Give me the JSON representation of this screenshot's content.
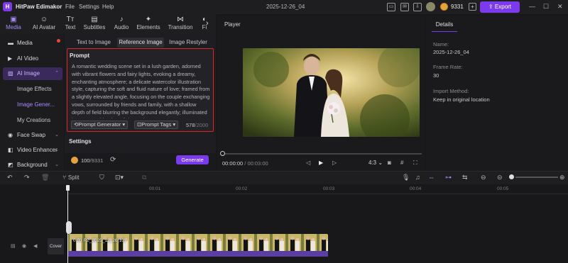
{
  "app": {
    "name": "HitPaw Edimakor",
    "menus": [
      "File",
      "Settings",
      "Help"
    ],
    "project_title": "2025-12-26_04",
    "coins": "9331",
    "export_label": "Export"
  },
  "top_tabs": [
    {
      "label": "Media",
      "icon": "media-icon",
      "active": true
    },
    {
      "label": "AI Avatar",
      "icon": "ai-avatar-icon"
    },
    {
      "label": "Text",
      "icon": "text-icon"
    },
    {
      "label": "Subtitles",
      "icon": "subtitles-icon"
    },
    {
      "label": "Audio",
      "icon": "audio-icon"
    },
    {
      "label": "Elements",
      "icon": "elements-icon"
    },
    {
      "label": "Transition",
      "icon": "transition-icon"
    },
    {
      "label": "Fi",
      "icon": "filters-icon"
    }
  ],
  "sidebar": {
    "items": [
      {
        "label": "Media"
      },
      {
        "label": "AI Video"
      },
      {
        "label": "AI Image",
        "active": true
      },
      {
        "label": "Face Swap"
      },
      {
        "label": "Video Enhancer"
      },
      {
        "label": "Background"
      }
    ],
    "sub_items": [
      {
        "label": "Image Effects"
      },
      {
        "label": "Image Gener...",
        "active": true
      },
      {
        "label": "My Creations"
      }
    ]
  },
  "image_tabs": [
    {
      "label": "Text to Image"
    },
    {
      "label": "Reference Image",
      "active": true
    },
    {
      "label": "Image Restyler"
    }
  ],
  "prompt": {
    "title": "Prompt",
    "text": "A romantic wedding scene set in a lush garden, adorned with vibrant flowers and fairy lights, evoking a dreamy, enchanting atmosphere; a delicate watercolor illustration style, capturing the soft and fluid nature of love; framed from a slightly elevated angle, focusing on the couple exchanging vows, surrounded by friends and family, with a shallow depth of field blurring the background elegantly; illuminated by warm, golden hour light casting",
    "generator_label": "Prompt Generator",
    "tags_label": "Prompt Tags",
    "count": "578",
    "max": "/2000"
  },
  "settings_label": "Settings",
  "generate": {
    "credits_used": "100",
    "credits_total": "/9331",
    "button_label": "Generate"
  },
  "player": {
    "label": "Player",
    "current_time": "00:00:00",
    "total_time": "/ 00:03:00",
    "aspect": "4:3"
  },
  "details": {
    "tab_label": "Details",
    "name_label": "Name:",
    "name_value": "2025-12-26_04",
    "frame_rate_label": "Frame Rate:",
    "frame_rate_value": "30",
    "import_label": "Import Method:",
    "import_value": "Keep in original location"
  },
  "toolbar": {
    "split_label": "Split"
  },
  "timeline": {
    "ruler": [
      "00:01",
      "00:02",
      "00:03",
      "00:04",
      "00:05"
    ],
    "cover_label": "Cover",
    "clip_label": "0:03 R2_2025_12_26(10)"
  },
  "colors": {
    "accent": "#7c3aed",
    "highlight_border": "#dc2626",
    "background": "#18181b"
  }
}
